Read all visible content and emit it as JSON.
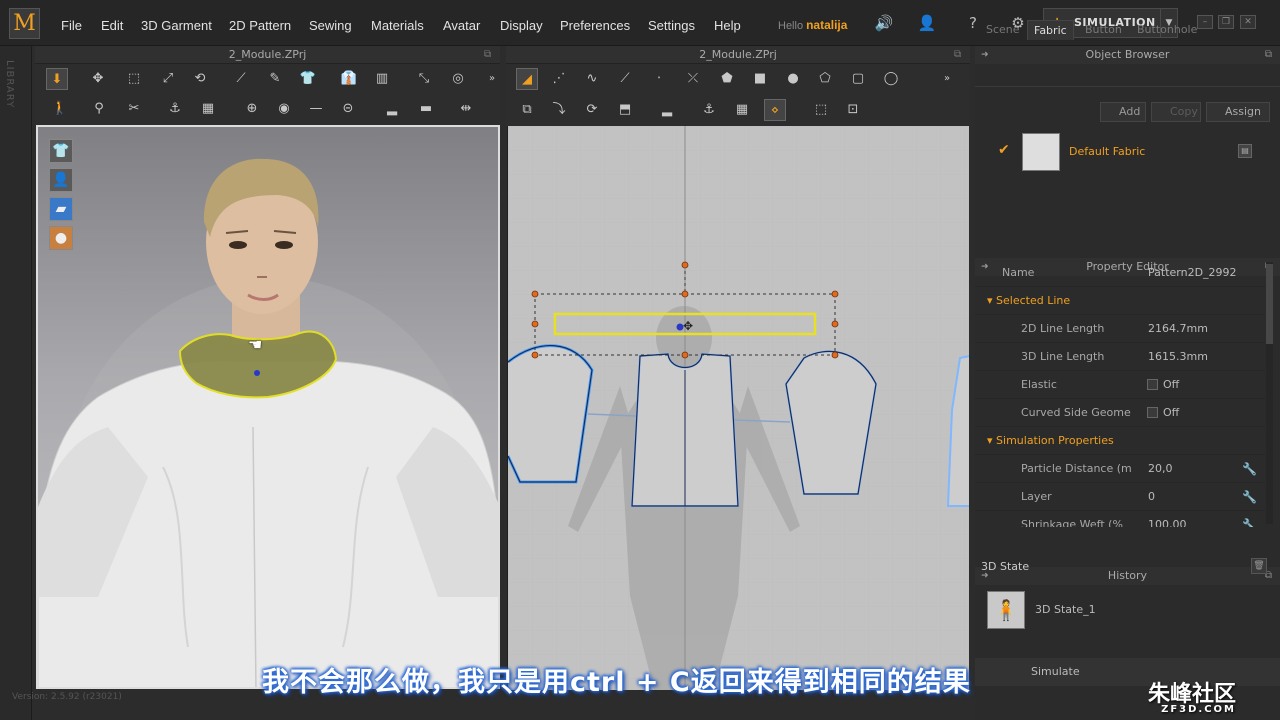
{
  "app": {
    "logo": "M"
  },
  "menu": [
    "File",
    "Edit",
    "3D Garment",
    "2D Pattern",
    "Sewing",
    "Materials",
    "Avatar",
    "Display",
    "Preferences",
    "Settings",
    "Help"
  ],
  "user": {
    "greeting": "Hello",
    "name": "natalija"
  },
  "simulation_button": "SIMULATION",
  "sidebar_label": "LIBRARY",
  "panels": {
    "view3d_title": "2_Module.ZPrj",
    "view2d_title": "2_Module.ZPrj"
  },
  "object_browser": {
    "title": "Object Browser",
    "tabs": [
      "Scene",
      "Fabric",
      "Button",
      "Buttonhole"
    ],
    "active_tab": "Fabric",
    "buttons": {
      "add": "Add",
      "copy": "Copy",
      "assign": "Assign"
    },
    "fabric_item": "Default Fabric"
  },
  "property_editor": {
    "title": "Property Editor",
    "name_label": "Name",
    "name_value": "Pattern2D_2992",
    "section_selected": "Selected Line",
    "rows_selected": [
      {
        "label": "2D Line Length",
        "value": "2164.7mm"
      },
      {
        "label": "3D Line Length",
        "value": "1615.3mm"
      },
      {
        "label": "Elastic",
        "value": "Off"
      },
      {
        "label": "Curved Side Geome",
        "value": "Off"
      }
    ],
    "section_sim": "Simulation Properties",
    "rows_sim": [
      {
        "label": "Particle Distance (m",
        "value": "20,0"
      },
      {
        "label": "Layer",
        "value": "0"
      },
      {
        "label": "Shrinkage Weft (%",
        "value": "100,00"
      }
    ]
  },
  "history": {
    "title": "History",
    "state_label": "3D State",
    "item": "3D State_1",
    "simulate": "Simulate"
  },
  "subtitle": "我不会那么做，我只是用ctrl + C返回来得到相同的结果",
  "watermark": {
    "main": "朱峰社区",
    "sub": "ZF3D.COM"
  },
  "version": "Version: 2.5.92    (r23021)",
  "colors": {
    "accent": "#f0a020",
    "selection": "#e8e020",
    "pattern_outline": "#4da3ff"
  }
}
